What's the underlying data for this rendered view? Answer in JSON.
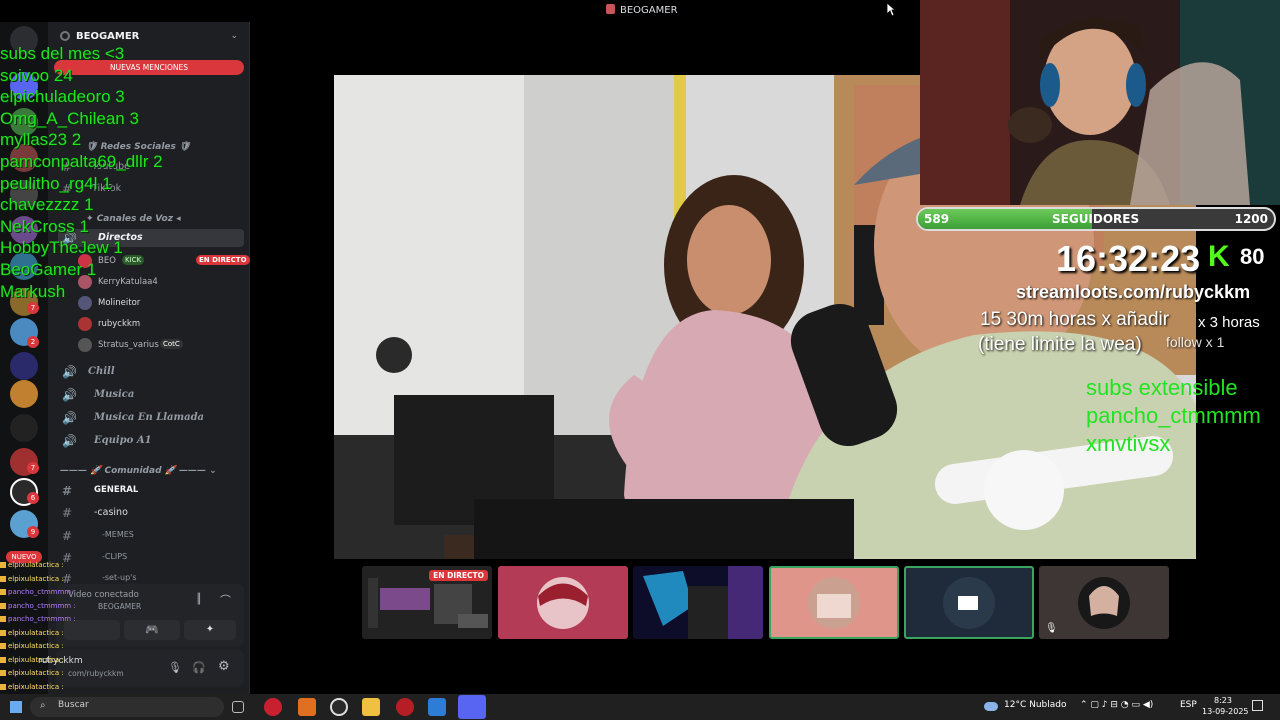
{
  "window": {
    "title": "BEOGAMER"
  },
  "server": {
    "name": "BEOGAMER",
    "mentions_banner": "NUEVAS MENCIONES",
    "categories": {
      "social": "Redes Sociales",
      "voice": "Canales de Voz",
      "community": "Comunidad"
    },
    "channels": {
      "youtube": "Youtube",
      "tiktok": "TikTok",
      "directos": "Directos",
      "chill": "Chill",
      "musica": "Musica",
      "musica_llamada": "Musica En Llamada",
      "equipo": "Equipo A1",
      "general": "GENERAL",
      "casino": "-casino",
      "memes": "-MEMES",
      "clips": "-CLIPS",
      "setups": "-set-up's"
    },
    "voice_users": [
      {
        "name": "BEO",
        "tag": "KICK",
        "status": "EN DIRECTO"
      },
      {
        "name": "KerryKatulaa4"
      },
      {
        "name": "Molineitor"
      },
      {
        "name": "rubyckkm"
      },
      {
        "name": "Stratus_varius",
        "tag": "CotC"
      }
    ],
    "new_badge": "NUEVO",
    "voice_connected": "Video conectado",
    "voice_channel_sub": "BEOGAMER",
    "self_user": {
      "name": "rubyckkm",
      "status": "com/rubyckkm"
    }
  },
  "overlay": {
    "chat_lines": [
      "subs del mes <3",
      "soivoo 24",
      "elpichuladeoro 3",
      "Omg_A_Chilean 3",
      "myllas23 2",
      "pamconpalta69_dllr 2",
      "peulitho_rg4l 1",
      "chavezzzz 1",
      "NekCross 1",
      "HobbyTheJew 1",
      "BeoGamer 1",
      "Markush"
    ],
    "followers": {
      "current": "589",
      "label": "SEGUIDORES",
      "goal": "1200",
      "progress": 0.49
    },
    "clock": "16:32:23",
    "kick_count": "80",
    "streamloots": "streamloots.com/rubyckkm",
    "rule_line1": "15 30m horas x añadir",
    "rule_line2": "(tiene limite la wea)",
    "rule_side1": "x 3 horas",
    "rule_side2": "follow x 1",
    "subs_lines": [
      "subs extensible",
      "pancho_ctmmmm",
      "xmvtivsx"
    ],
    "small_chat": [
      "elpixulatactica :",
      "elpixulatactica :",
      "pancho_ctmmmm :",
      "pancho_ctmmmm :",
      "pancho_ctmmmm :",
      "elpixulatactica :",
      "elpixulatactica :",
      "elpixulatactica :",
      "elpixulatactica :",
      "elpixulatactica :",
      "elpixulatactica :"
    ]
  },
  "thumbs": {
    "live_label": "EN DIRECTO"
  },
  "taskbar": {
    "search": "Buscar",
    "weather": "12°C Nublado",
    "lang": "ESP",
    "time": "8:23",
    "date": "13-09-2025"
  },
  "colors": {
    "accent_green": "#22e322",
    "discord_red": "#da373c",
    "kick_green": "#53fc18"
  }
}
